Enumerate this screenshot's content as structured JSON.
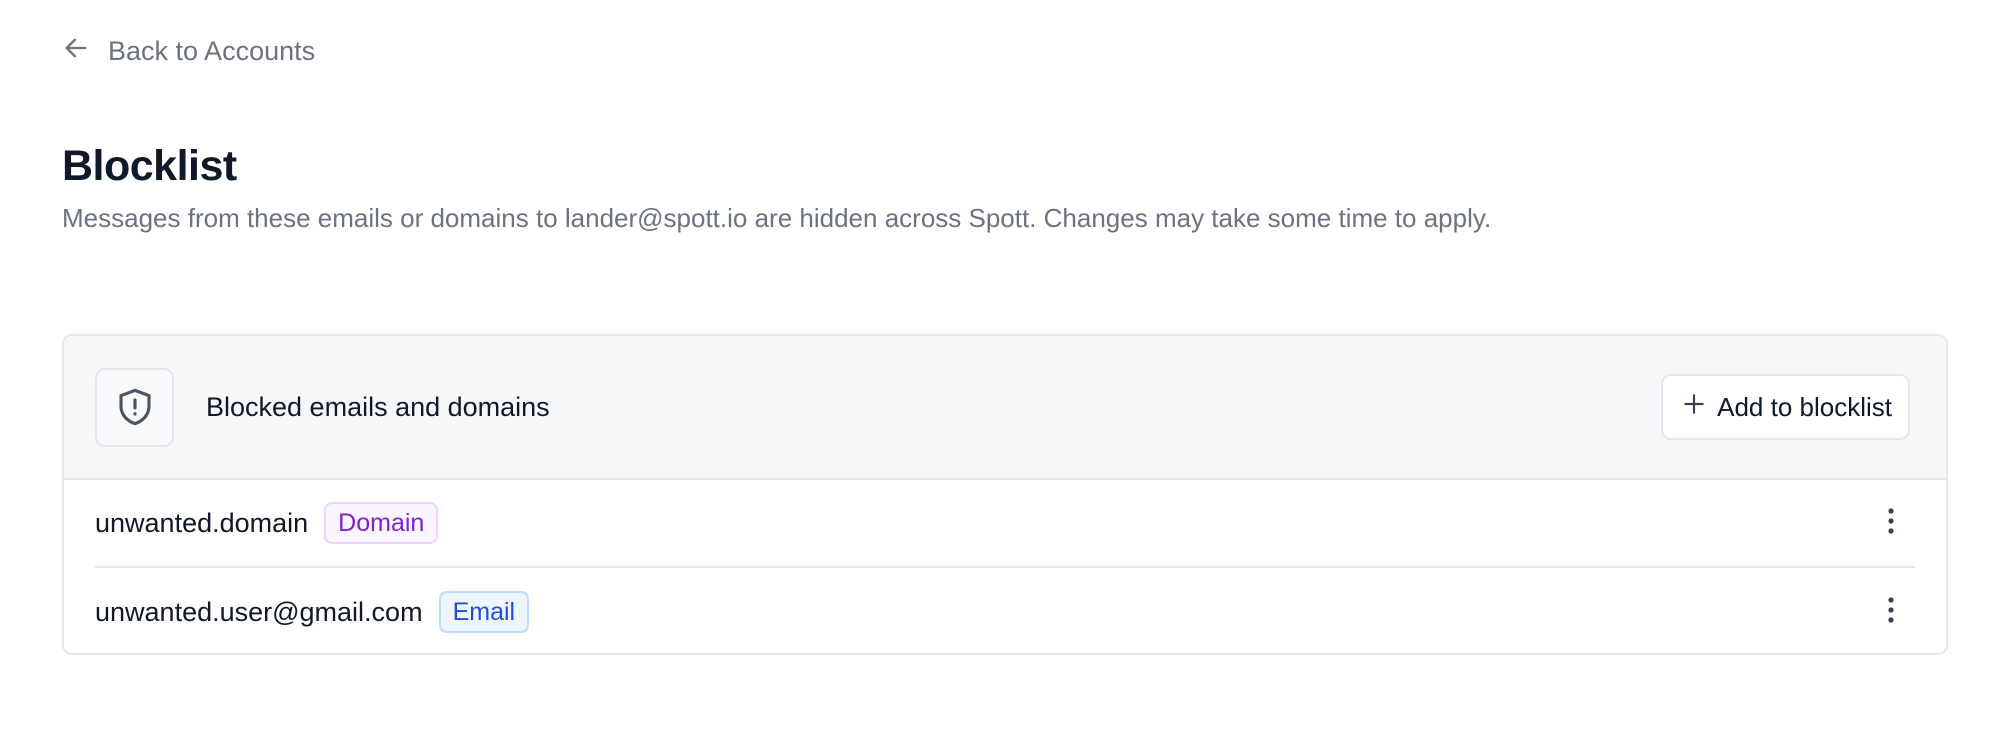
{
  "nav": {
    "back_label": "Back to Accounts"
  },
  "page": {
    "title": "Blocklist",
    "description": "Messages from these emails or domains to lander@spott.io are hidden across Spott. Changes may take some time to apply."
  },
  "card": {
    "title": "Blocked emails and domains",
    "header_icon": "shield-alert-icon",
    "add_button_label": "Add to blocklist",
    "rows": [
      {
        "value": "unwanted.domain",
        "type_label": "Domain",
        "type": "domain"
      },
      {
        "value": "unwanted.user@gmail.com",
        "type_label": "Email",
        "type": "email"
      }
    ]
  },
  "colors": {
    "domain_badge_text": "#7e22ce",
    "email_badge_text": "#1d4ed8",
    "muted_text": "#6b7280",
    "header_bg": "#f7f8fa"
  }
}
